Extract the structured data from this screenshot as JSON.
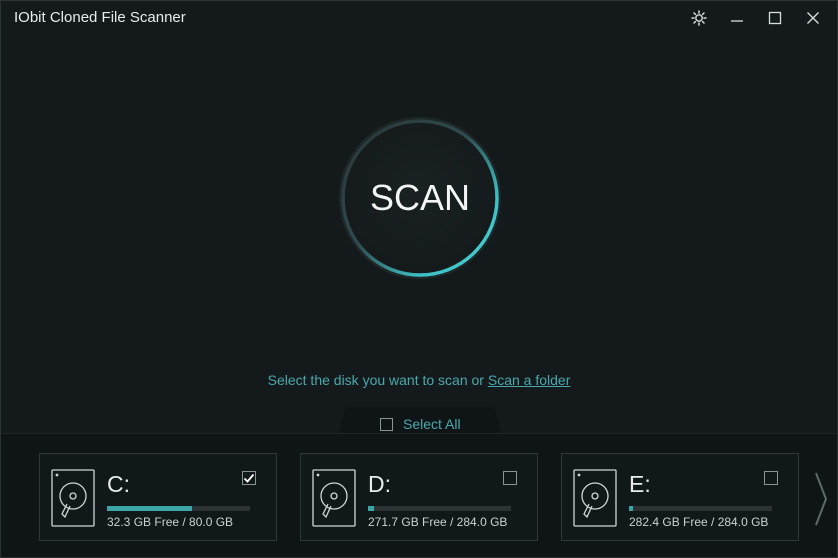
{
  "window": {
    "title": "IObit Cloned File Scanner"
  },
  "titlebar": {
    "icons": [
      "settings-gear-icon",
      "minimize-icon",
      "maximize-icon",
      "close-icon"
    ]
  },
  "scan": {
    "label": "SCAN"
  },
  "hint": {
    "text": "Select the disk you want to scan or",
    "link": "Scan a folder"
  },
  "select_all": {
    "label": "Select All",
    "checked": false
  },
  "drives": [
    {
      "letter": "C:",
      "space": "32.3 GB Free / 80.0 GB",
      "checked": true,
      "used_fraction": 0.596
    },
    {
      "letter": "D:",
      "space": "271.7 GB Free / 284.0 GB",
      "checked": false,
      "used_fraction": 0.043
    },
    {
      "letter": "E:",
      "space": "282.4 GB Free / 284.0 GB",
      "checked": false,
      "used_fraction": 0.006
    }
  ],
  "colors": {
    "accent": "#3dbfc4",
    "link": "#4aa8ad",
    "background": "#141a1b",
    "panel": "#0f1516"
  }
}
